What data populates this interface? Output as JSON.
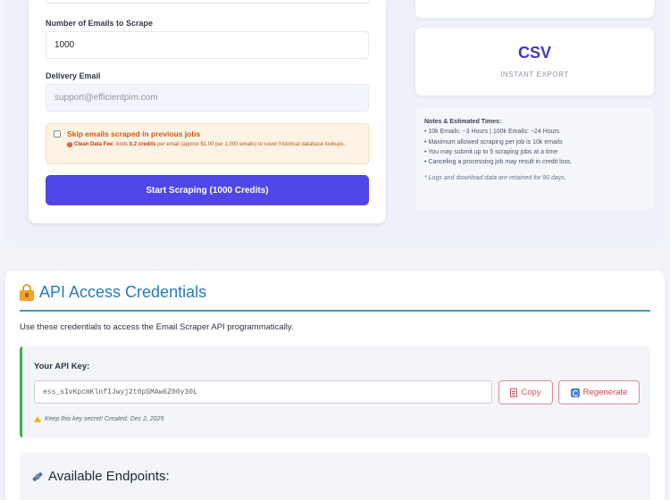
{
  "scraper_form": {
    "count_label": "Number of Emails to Scrape",
    "count_value": "1000",
    "delivery_label": "Delivery Email",
    "delivery_value": "support@efficientpim.com",
    "skip_label": "Skip emails scraped in previous jobs",
    "skip_checked": false,
    "skip_note_prefix": "Clean Data Fee:",
    "skip_note_mid": "Adds",
    "skip_note_credits": "0.2 credits",
    "skip_note_rest": "per email (approx $1.00 per 1,000 emails) to cover historical database lookups.",
    "start_button": "Start Scraping (1000 Credits)"
  },
  "export_card": {
    "title": "CSV",
    "subtitle": "INSTANT EXPORT"
  },
  "notes": {
    "title": "Notes & Estimated Times:",
    "items": [
      "• 10k Emails: ~3 Hours | 100k Emails: ~24 Hours",
      "• Maximum allowed scraping per job is 10k emails",
      "• You may submit up to 5 scraping jobs at a time",
      "• Canceling a processing job may result in credit loss."
    ],
    "footer": "* Logs and download data are retained for 90 days."
  },
  "api": {
    "title": "API Access Credentials",
    "description": "Use these credentials to access the Email Scraper API programmatically.",
    "key_label": "Your API Key:",
    "key_value": "ess_sIvKpcmKlnfIJwyj2t0pSMAw6Z00y30L",
    "copy_button": "Copy",
    "regenerate_button": "Regenerate",
    "key_warning": "Keep this key secret! Created: Dec 2, 2025",
    "endpoints_title": "Available Endpoints:"
  },
  "colors": {
    "primary": "#4f46e5",
    "api_title": "#2a7ab8",
    "danger_outline": "#e08b95",
    "success_border": "#3fae5a"
  }
}
